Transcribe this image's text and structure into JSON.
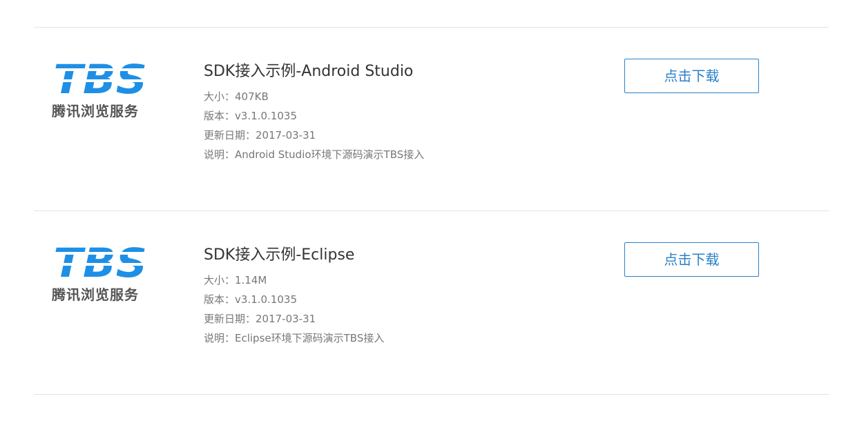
{
  "items": [
    {
      "logo_mark": "TBS",
      "logo_text": "腾讯浏览服务",
      "title": "SDK接入示例-Android Studio",
      "size": "大小：407KB",
      "version": "版本：v3.1.0.1035",
      "date": "更新日期：2017-03-31",
      "description": "说明：Android Studio环境下源码演示TBS接入",
      "download_label": "点击下载"
    },
    {
      "logo_mark": "TBS",
      "logo_text": "腾讯浏览服务",
      "title": "SDK接入示例-Eclipse",
      "size": "大小：1.14M",
      "version": "版本：v3.1.0.1035",
      "date": "更新日期：2017-03-31",
      "description": "说明：Eclipse环境下源码演示TBS接入",
      "download_label": "点击下载"
    }
  ],
  "colors": {
    "logo_blue": "#1e8fe6",
    "button_blue": "#2a80c8",
    "divider": "#e3e3e3"
  }
}
